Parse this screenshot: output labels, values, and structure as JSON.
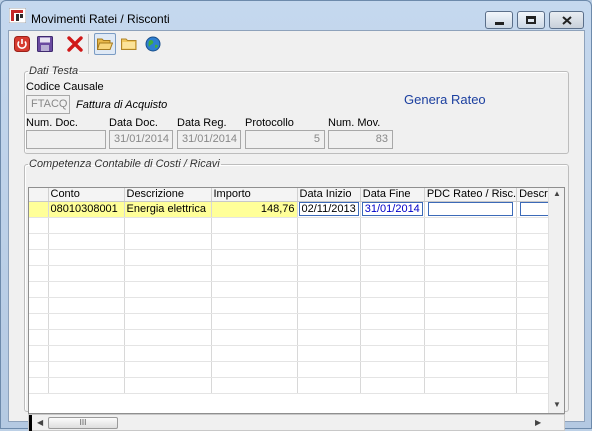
{
  "window": {
    "title": "Movimenti Ratei / Risconti",
    "accent": "#1b3f9f"
  },
  "toolbar": {
    "buttons": [
      {
        "name": "power-icon",
        "color": "#d63b2f"
      },
      {
        "name": "save-icon",
        "color": "#6a4aa0"
      },
      {
        "name": "delete-icon",
        "color": "#d01818"
      },
      {
        "name": "open-folder-icon",
        "color": "#e8b84a"
      },
      {
        "name": "folder-icon",
        "color": "#f0c860"
      },
      {
        "name": "globe-icon",
        "color": "#2d7fd0"
      }
    ]
  },
  "header": {
    "legend": "Dati Testa",
    "codice_causale_label": "Codice Causale",
    "codice_causale_value": "FTACQ",
    "causale_description": "Fattura di Acquisto",
    "genera_rateo": "Genera Rateo",
    "num_doc_label": "Num. Doc.",
    "num_doc_value": "",
    "data_doc_label": "Data Doc.",
    "data_doc_value": "31/01/2014",
    "data_reg_label": "Data Reg.",
    "data_reg_value": "31/01/2014",
    "protocollo_label": "Protocollo",
    "protocollo_value": "5",
    "num_mov_label": "Num. Mov.",
    "num_mov_value": "83"
  },
  "competenza": {
    "legend": "Competenza Contabile di Costi / Ricavi",
    "columns": [
      "Conto",
      "Descrizione",
      "Importo",
      "Data Inizio",
      "Data Fine",
      "PDC Rateo / Risc.",
      "Descriz"
    ],
    "rows": [
      {
        "conto": "08010308001",
        "descrizione": "Energia elettrica",
        "importo": "148,76",
        "data_inizio": "02/11/2013",
        "data_fine": "31/01/2014",
        "pdc": "",
        "descriz": ""
      }
    ],
    "empty_rows": 11,
    "thumb_grip": "III"
  }
}
